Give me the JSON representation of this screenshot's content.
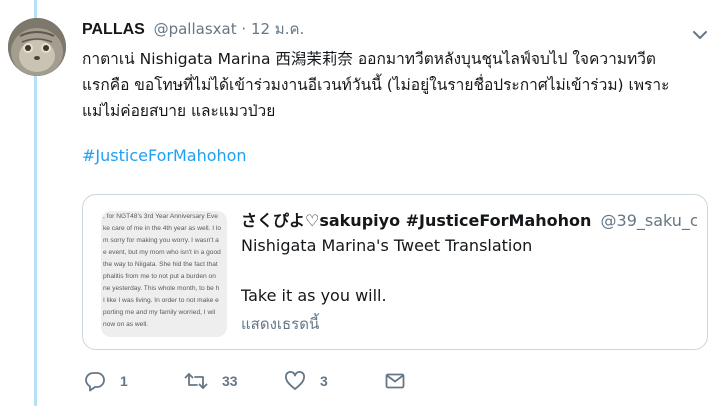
{
  "tweet": {
    "author_name": "PALLAS",
    "author_handle": "@pallasxat",
    "separator": "·",
    "timestamp": "12 ม.ค.",
    "text_lines": [
      "กาตาเน่ Nishigata Marina 西潟茉莉奈 ออกมาทวีตหลังบุนชุนไลฟ์จบไป ใจความทวีต",
      "แรกคือ ขอโทษที่ไม่ได้เข้าร่วมงานอีเวนท์วันนี้ (ไม่อยู่ในรายชื่อประกาศไม่เข้าร่วม) เพราะ",
      "แม่ไม่ค่อยสบาย และแมวป่วย"
    ],
    "hashtag": "#JusticeForMahohon"
  },
  "quoted_tweet": {
    "author_name": "さくぴよ♡sakupiyo #JusticeForMahohon",
    "author_handle": "@39_saku_c...",
    "line1": "Nishigata Marina's Tweet Translation",
    "line2": "Take it as you will.",
    "show_thread": "แสดงเธรดนี้",
    "image_lines": [
      ", for NGT48's 3rd Year Anniversary Eve",
      "ke care of me in the 4th year as well. I lo",
      "m sorry for making you worry. I wasn't a",
      "e event, but my mom who isn't in a good",
      "the way to Niigata. She hid the fact that",
      "phalitis from me to not put a burden on",
      "ne yesterday. This whole month, to be h",
      "I like I was living. In order to not make e",
      "porting me and my family worried, I wil",
      "now on as well."
    ]
  },
  "actions": {
    "reply_count": "1",
    "retweet_count": "33",
    "like_count": "3"
  },
  "colors": {
    "link": "#1da1f2",
    "muted": "#657786",
    "thread_line": "#b6e0f6",
    "border": "#ccd6dd"
  },
  "icons": [
    "chevron-down-icon",
    "reply-icon",
    "retweet-icon",
    "heart-icon",
    "dm-envelope-icon"
  ]
}
